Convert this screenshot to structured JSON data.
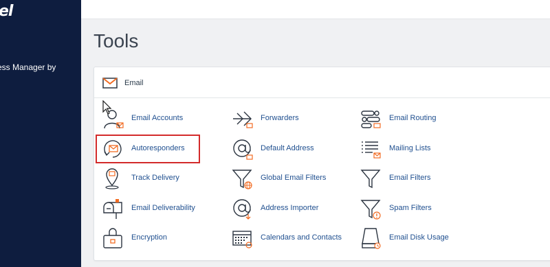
{
  "brand": {
    "logo_text": "el",
    "sidebar_text": "ess Manager by"
  },
  "page": {
    "title": "Tools"
  },
  "section": {
    "title": "Email",
    "icon": "envelope-icon"
  },
  "tools": [
    {
      "label": "Email Accounts",
      "icon": "user-mail-icon"
    },
    {
      "label": "Forwarders",
      "icon": "forward-arrow-icon"
    },
    {
      "label": "Email Routing",
      "icon": "routing-icon"
    },
    {
      "label": "Autoresponders",
      "icon": "autoresponder-icon"
    },
    {
      "label": "Default Address",
      "icon": "at-sign-icon"
    },
    {
      "label": "Mailing Lists",
      "icon": "mailing-list-icon"
    },
    {
      "label": "Track Delivery",
      "icon": "location-pin-icon"
    },
    {
      "label": "Global Email Filters",
      "icon": "globe-filter-icon"
    },
    {
      "label": "Email Filters",
      "icon": "filter-icon"
    },
    {
      "label": "Email Deliverability",
      "icon": "mailbox-icon"
    },
    {
      "label": "Address Importer",
      "icon": "at-import-icon"
    },
    {
      "label": "Spam Filters",
      "icon": "spam-filter-icon"
    },
    {
      "label": "Encryption",
      "icon": "lock-box-icon"
    },
    {
      "label": "Calendars and Contacts",
      "icon": "calendar-icon"
    },
    {
      "label": "Email Disk Usage",
      "icon": "disk-usage-icon"
    }
  ],
  "highlighted_tool": "Autoresponders",
  "colors": {
    "sidebar": "#0e1d3f",
    "accent_orange": "#f26c23",
    "link": "#1f4f8f",
    "highlight_border": "#d32a2a"
  }
}
